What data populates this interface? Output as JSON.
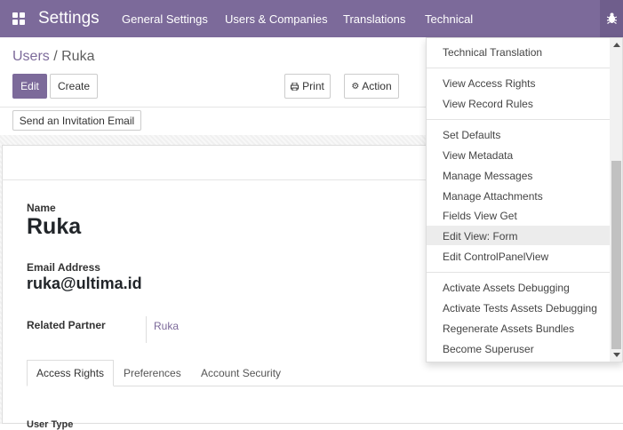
{
  "topbar": {
    "app_title": "Settings",
    "menu": [
      "General Settings",
      "Users & Companies",
      "Translations",
      "Technical"
    ]
  },
  "breadcrumb": {
    "parent": "Users",
    "separator": " / ",
    "current": "Ruka"
  },
  "buttons": {
    "edit": "Edit",
    "create": "Create",
    "print": "Print",
    "action": "Action",
    "invite": "Send an Invitation Email"
  },
  "form": {
    "name_label": "Name",
    "name_value": "Ruka",
    "email_label": "Email Address",
    "email_value": "ruka@ultima.id",
    "partner_label": "Related Partner",
    "partner_value": "Ruka",
    "cut_label": "User Type"
  },
  "tabs": [
    "Access Rights",
    "Preferences",
    "Account Security"
  ],
  "debug_menu": {
    "groups": [
      [
        "Technical Translation"
      ],
      [
        "View Access Rights",
        "View Record Rules"
      ],
      [
        "Set Defaults",
        "View Metadata",
        "Manage Messages",
        "Manage Attachments",
        "Fields View Get",
        "Edit View: Form",
        "Edit ControlPanelView"
      ],
      [
        "Activate Assets Debugging",
        "Activate Tests Assets Debugging",
        "Regenerate Assets Bundles",
        "Become Superuser"
      ]
    ],
    "highlighted": "Edit View: Form"
  },
  "colors": {
    "brand": "#7c6a9a",
    "link": "#7c6a9a"
  },
  "icons": {
    "apps": "apps-grid-icon",
    "debug": "bug-icon",
    "print": "print-icon",
    "action": "gear-icon"
  }
}
